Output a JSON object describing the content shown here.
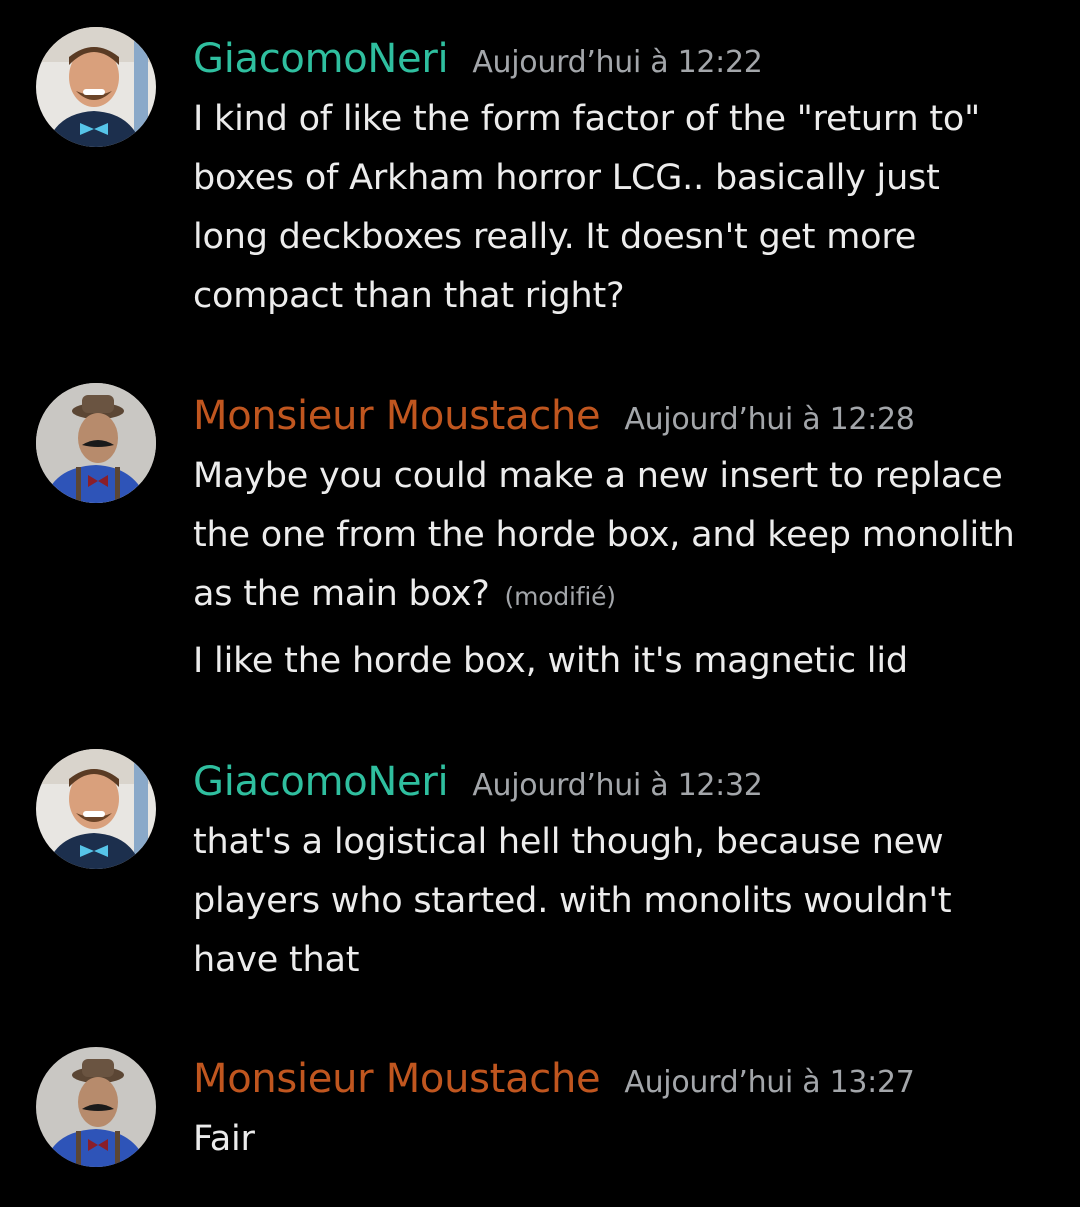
{
  "colors": {
    "background": "#000000",
    "username_giacomo": "#2fbf9f",
    "username_moustache": "#c0561f",
    "timestamp": "#a3a6aa",
    "text": "#ececec"
  },
  "messages": [
    {
      "username": "GiacomoNeri",
      "timestamp": "Aujourd’hui à 12:22",
      "lines": [
        "I kind of like the form factor of the \"return to\"",
        "boxes of Arkham horror LCG.. basically just",
        "long deckboxes really.  It doesn't get more",
        "compact than that right?"
      ]
    },
    {
      "username": "Monsieur Moustache",
      "timestamp": "Aujourd’hui à 12:28",
      "lines": [
        "Maybe you could make a new insert to replace",
        "the one from the horde box, and keep monolith",
        "as the main box?"
      ],
      "edited_label": "(modifié)",
      "followup": "I like the horde box, with it's magnetic lid"
    },
    {
      "username": "GiacomoNeri",
      "timestamp": "Aujourd’hui à 12:32",
      "lines": [
        "that's a logistical hell though, because new",
        "players who started. with monolits wouldn't",
        "have that"
      ]
    },
    {
      "username": "Monsieur Moustache",
      "timestamp": "Aujourd’hui à 13:27",
      "lines": [
        "Fair"
      ]
    }
  ]
}
